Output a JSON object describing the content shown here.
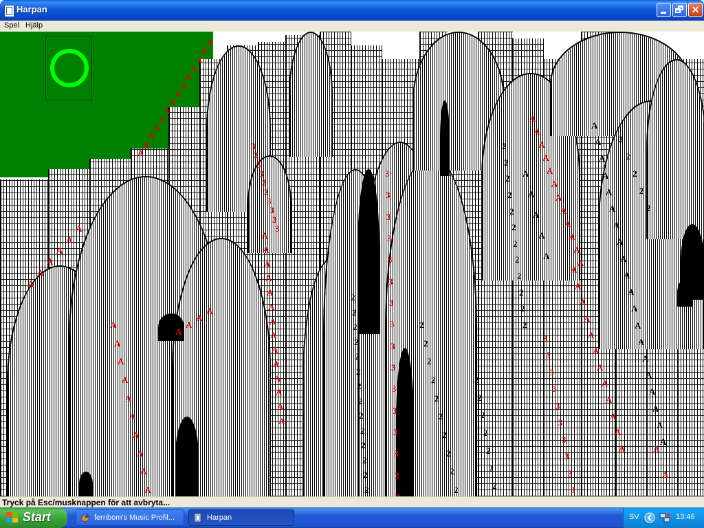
{
  "window": {
    "title": "Harpan"
  },
  "menu": {
    "items": [
      "Spel",
      "Hjälp"
    ]
  },
  "status": {
    "text": "Tryck på Esc/musknappen för att avbryta..."
  },
  "taskbar": {
    "start_label": "Start",
    "tasks": [
      {
        "label": "fernbom's Music Profil...",
        "icon": "firefox-icon"
      },
      {
        "label": "Harpan",
        "icon": "solitaire-icon"
      }
    ],
    "language": "SV",
    "clock": "13:46"
  },
  "colors": {
    "felt": "#008000",
    "ring": "#00ff00",
    "red_suit": "#e00000",
    "titlebar": "#0b5ad8",
    "taskbar": "#2157d7",
    "start": "#37a237"
  },
  "game": {
    "card_labels": [
      "A",
      "2",
      "3"
    ]
  }
}
